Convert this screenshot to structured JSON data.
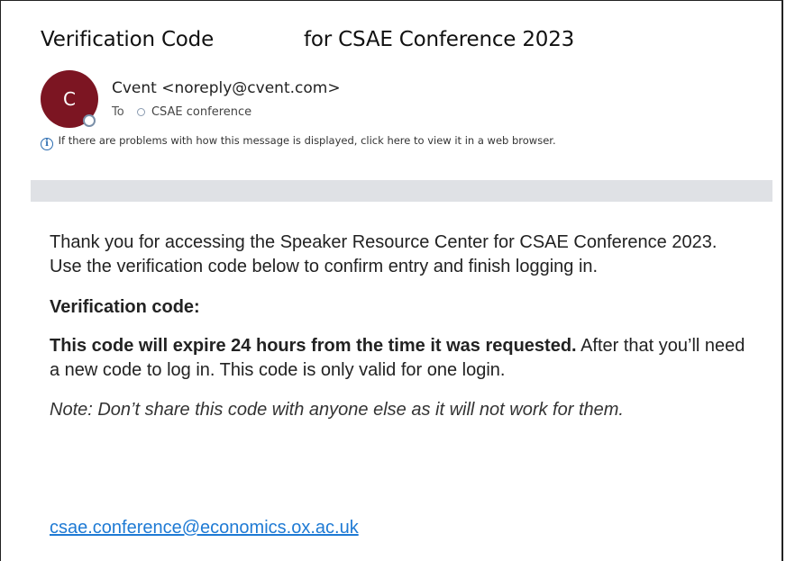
{
  "email": {
    "subject_part1": "Verification Code",
    "subject_part2": "for CSAE Conference 2023",
    "sender": {
      "avatar_letter": "C",
      "avatar_color": "#7c1522",
      "display": "Cvent <noreply@cvent.com>"
    },
    "to_label": "To",
    "recipient": "CSAE conference",
    "info_icon": "info-icon",
    "info_message": "If there are problems with how this message is displayed, click here to view it in a web browser."
  },
  "body": {
    "paragraph1": "Thank you for accessing the Speaker Resource Center for CSAE Conference 2023. Use the verification code below to confirm entry and finish logging in.",
    "verification_label": "Verification code:",
    "expiry_bold": "This code will expire 24 hours from the time it was requested.",
    "expiry_rest": " After that you’ll need a new code to log in. This code is only valid for one login.",
    "note": "Note: Don’t share this code with anyone else as it will not work for them.",
    "contact_link": "csae.conference@economics.ox.ac.uk",
    "link_color": "#1e7ad4"
  }
}
